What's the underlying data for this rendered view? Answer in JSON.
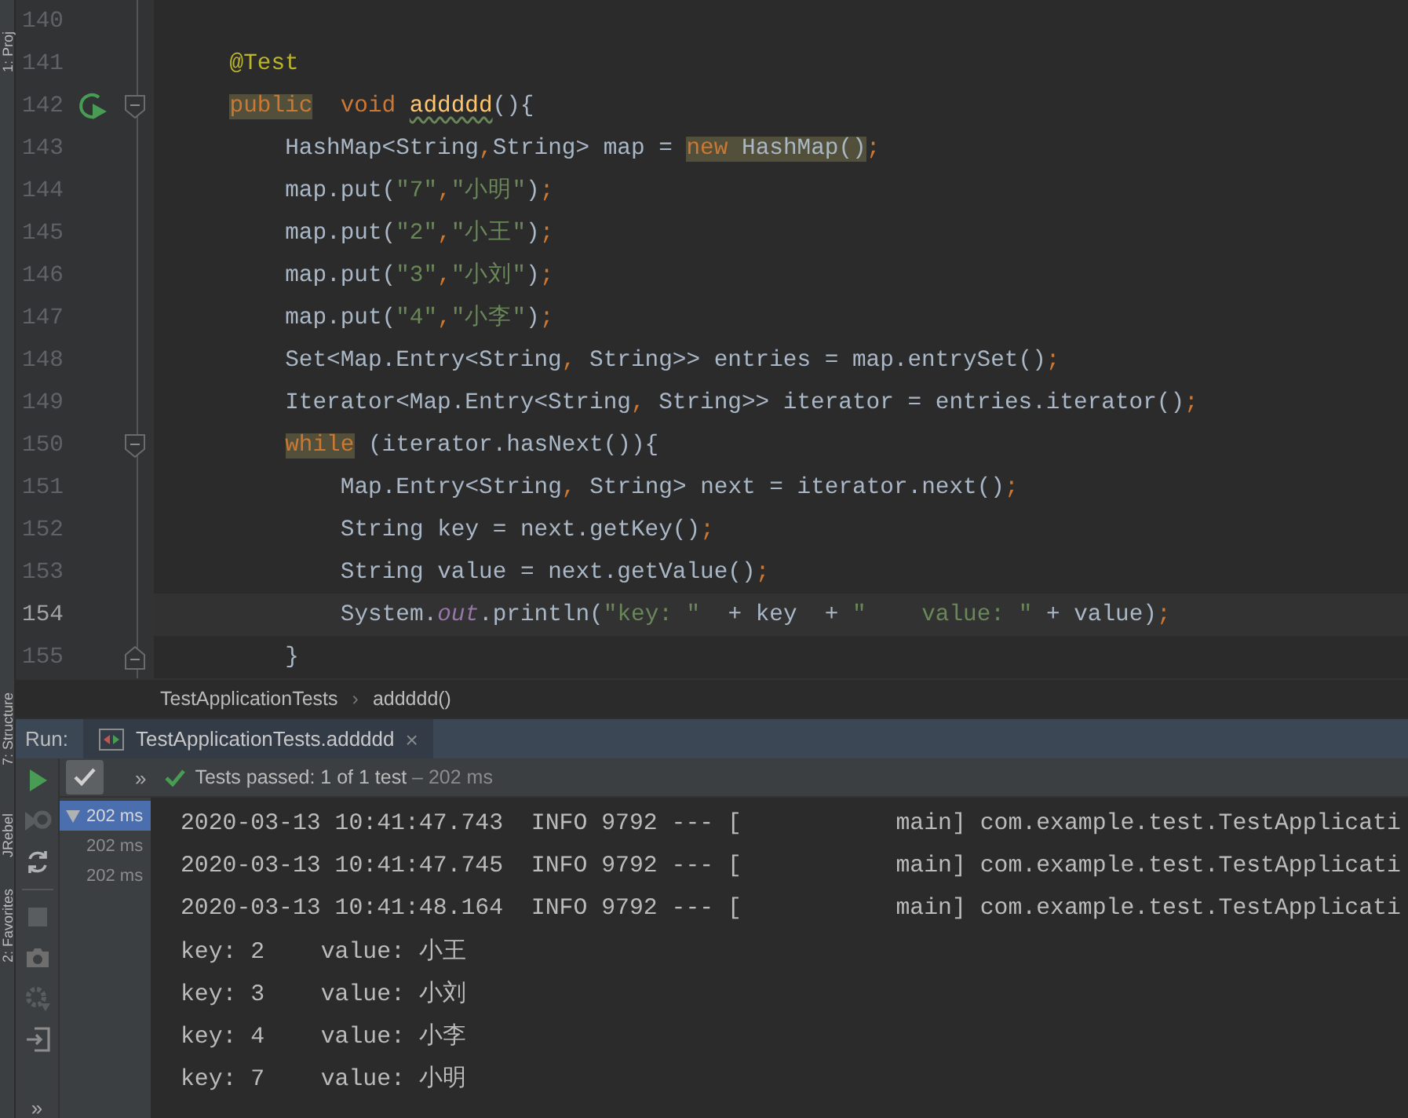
{
  "tool_strip": {
    "labels": [
      "1: Proj",
      "7: Structure",
      "JRebel",
      "2: Favorites"
    ]
  },
  "editor": {
    "lines": [
      {
        "number": "140",
        "current": false,
        "run_marker": false,
        "fold_open": false,
        "fold_close": false
      },
      {
        "number": "141",
        "current": false,
        "run_marker": false,
        "fold_open": false,
        "fold_close": false,
        "tokens": [
          {
            "text": "@Test",
            "kind": "annotation"
          }
        ]
      },
      {
        "number": "142",
        "current": false,
        "run_marker": true,
        "fold_open": true,
        "fold_close": false,
        "tokens": [
          {
            "text": "public",
            "kind": "keyword",
            "highlighted": true
          },
          {
            "text": "  void ",
            "kind": "keyword"
          },
          {
            "text": "addddd",
            "kind": "method",
            "warning": true
          },
          {
            "text": "(){",
            "kind": "plain"
          }
        ],
        "children": [
          {
            "number": "143",
            "current": false,
            "run_marker": false,
            "fold_open": false,
            "fold_close": false,
            "tokens": [
              {
                "text": "HashMap<String",
                "kind": "plain"
              },
              {
                "text": ",",
                "kind": "punct"
              },
              {
                "text": "String> map = ",
                "kind": "plain"
              },
              {
                "text": "new",
                "kind": "keyword",
                "highlighted": true
              },
              {
                "text": " HashMap()",
                "kind": "plain",
                "highlighted": true
              },
              {
                "text": ";",
                "kind": "punct"
              }
            ]
          },
          {
            "number": "144",
            "current": false,
            "run_marker": false,
            "fold_open": false,
            "fold_close": false,
            "tokens": [
              {
                "text": "map.put(",
                "kind": "plain"
              },
              {
                "text": "\"7\"",
                "kind": "string"
              },
              {
                "text": ",",
                "kind": "punct"
              },
              {
                "text": "\"小明\"",
                "kind": "string"
              },
              {
                "text": ")",
                "kind": "plain"
              },
              {
                "text": ";",
                "kind": "punct"
              }
            ]
          },
          {
            "number": "145",
            "current": false,
            "run_marker": false,
            "fold_open": false,
            "fold_close": false,
            "tokens": [
              {
                "text": "map.put(",
                "kind": "plain"
              },
              {
                "text": "\"2\"",
                "kind": "string"
              },
              {
                "text": ",",
                "kind": "punct"
              },
              {
                "text": "\"小王\"",
                "kind": "string"
              },
              {
                "text": ")",
                "kind": "plain"
              },
              {
                "text": ";",
                "kind": "punct"
              }
            ]
          },
          {
            "number": "146",
            "current": false,
            "run_marker": false,
            "fold_open": false,
            "fold_close": false,
            "tokens": [
              {
                "text": "map.put(",
                "kind": "plain"
              },
              {
                "text": "\"3\"",
                "kind": "string"
              },
              {
                "text": ",",
                "kind": "punct"
              },
              {
                "text": "\"小刘\"",
                "kind": "string"
              },
              {
                "text": ")",
                "kind": "plain"
              },
              {
                "text": ";",
                "kind": "punct"
              }
            ]
          },
          {
            "number": "147",
            "current": false,
            "run_marker": false,
            "fold_open": false,
            "fold_close": false,
            "tokens": [
              {
                "text": "map.put(",
                "kind": "plain"
              },
              {
                "text": "\"4\"",
                "kind": "string"
              },
              {
                "text": ",",
                "kind": "punct"
              },
              {
                "text": "\"小李\"",
                "kind": "string"
              },
              {
                "text": ")",
                "kind": "plain"
              },
              {
                "text": ";",
                "kind": "punct"
              }
            ]
          },
          {
            "number": "148",
            "current": false,
            "run_marker": false,
            "fold_open": false,
            "fold_close": false,
            "tokens": [
              {
                "text": "Set<Map.Entry<String",
                "kind": "plain"
              },
              {
                "text": ",",
                "kind": "punct"
              },
              {
                "text": " String>> entries = map.entrySet()",
                "kind": "plain"
              },
              {
                "text": ";",
                "kind": "punct"
              }
            ]
          },
          {
            "number": "149",
            "current": false,
            "run_marker": false,
            "fold_open": false,
            "fold_close": false,
            "tokens": [
              {
                "text": "Iterator<Map.Entry<String",
                "kind": "plain"
              },
              {
                "text": ",",
                "kind": "punct"
              },
              {
                "text": " String>> iterator = entries.iterator()",
                "kind": "plain"
              },
              {
                "text": ";",
                "kind": "punct"
              }
            ]
          },
          {
            "number": "150",
            "current": false,
            "run_marker": false,
            "fold_open": true,
            "fold_close": false,
            "tokens": [
              {
                "text": "while",
                "kind": "keyword",
                "highlighted": true
              },
              {
                "text": " (iterator.hasNext()){",
                "kind": "plain"
              }
            ],
            "children": [
              {
                "number": "151",
                "current": false,
                "run_marker": false,
                "fold_open": false,
                "fold_close": false,
                "tokens": [
                  {
                    "text": "Map.Entry<String",
                    "kind": "plain"
                  },
                  {
                    "text": ",",
                    "kind": "punct"
                  },
                  {
                    "text": " String> next = iterator.next()",
                    "kind": "plain"
                  },
                  {
                    "text": ";",
                    "kind": "punct"
                  }
                ]
              },
              {
                "number": "152",
                "current": false,
                "run_marker": false,
                "fold_open": false,
                "fold_close": false,
                "tokens": [
                  {
                    "text": "String key = next.getKey()",
                    "kind": "plain"
                  },
                  {
                    "text": ";",
                    "kind": "punct"
                  }
                ]
              },
              {
                "number": "153",
                "current": false,
                "run_marker": false,
                "fold_open": false,
                "fold_close": false,
                "tokens": [
                  {
                    "text": "String value = next.getValue()",
                    "kind": "plain"
                  },
                  {
                    "text": ";",
                    "kind": "punct"
                  }
                ]
              },
              {
                "number": "154",
                "current": true,
                "run_marker": false,
                "fold_open": false,
                "fold_close": false,
                "tokens": [
                  {
                    "text": "System.",
                    "kind": "plain"
                  },
                  {
                    "text": "out",
                    "kind": "field"
                  },
                  {
                    "text": ".println(",
                    "kind": "plain"
                  },
                  {
                    "text": "\"key: \"",
                    "kind": "string"
                  },
                  {
                    "text": "  + key  + ",
                    "kind": "plain"
                  },
                  {
                    "text": "\"    value: \"",
                    "kind": "string"
                  },
                  {
                    "text": " + value)",
                    "kind": "plain"
                  },
                  {
                    "text": ";",
                    "kind": "punct"
                  }
                ]
              }
            ]
          },
          {
            "number": "155",
            "current": false,
            "run_marker": false,
            "fold_open": false,
            "fold_close": true,
            "tokens": [
              {
                "text": "}",
                "kind": "plain"
              }
            ]
          }
        ]
      }
    ]
  },
  "breadcrumb": {
    "items": [
      "TestApplicationTests",
      "addddd()"
    ],
    "separator": "›"
  },
  "run_panel": {
    "title": "Run:",
    "tab": {
      "label": "TestApplicationTests.addddd",
      "close": "×"
    },
    "show_passed": true,
    "overflow": "»",
    "more": "»",
    "status": {
      "passed": "Tests passed:",
      "count": "1 of 1 test",
      "duration": "– 202 ms"
    },
    "tree": [
      {
        "label": "202 ms",
        "kind": "suite",
        "selected": true
      },
      {
        "label": "202 ms",
        "kind": "test",
        "selected": false
      },
      {
        "label": "202 ms",
        "kind": "test",
        "selected": false
      }
    ],
    "console": [
      {
        "text": "2020-03-13 10:41:47.743  INFO 9792 --- [           main] com.example.test.TestApplicati"
      },
      {
        "text": "2020-03-13 10:41:47.745  INFO 9792 --- [           main] com.example.test.TestApplicati"
      },
      {
        "text": "2020-03-13 10:41:48.164  INFO 9792 --- [           main] com.example.test.TestApplicati"
      },
      {
        "text": "key: 2    value: 小王"
      },
      {
        "text": "key: 3    value: 小刘"
      },
      {
        "text": "key: 4    value: 小李"
      },
      {
        "text": "key: 7    value: 小明"
      }
    ]
  }
}
